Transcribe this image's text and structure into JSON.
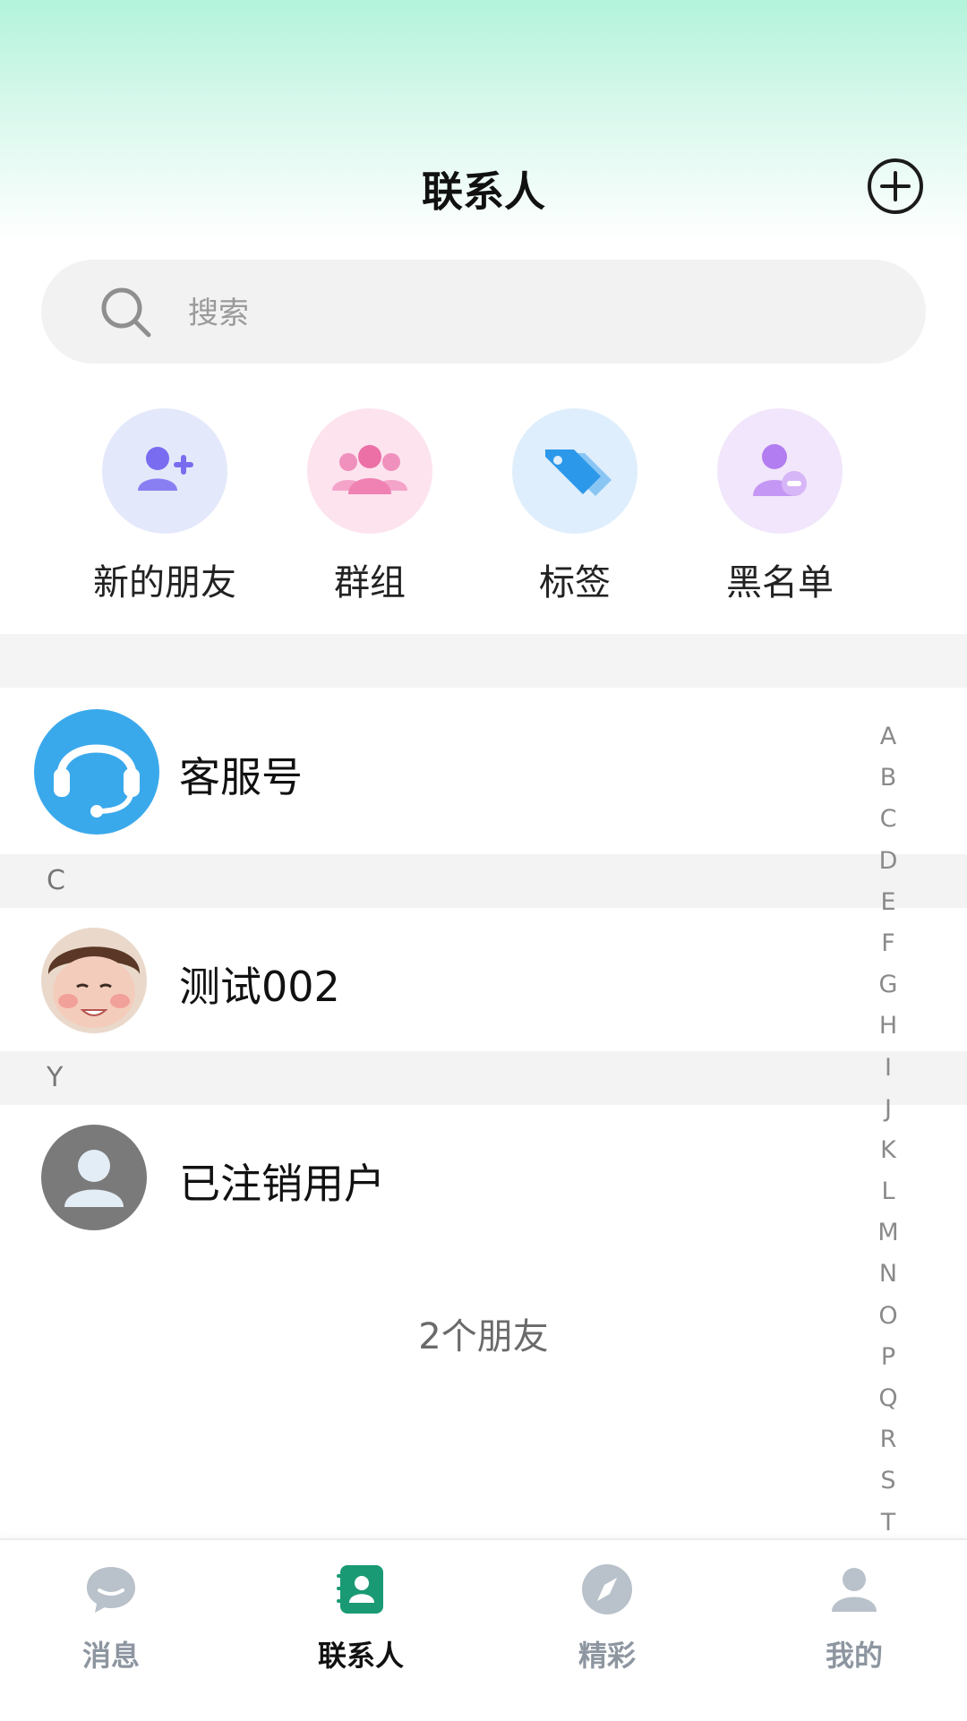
{
  "header": {
    "title": "联系人"
  },
  "search": {
    "placeholder": "搜索"
  },
  "quick_actions": [
    {
      "label": "新的朋友",
      "icon": "add-friend-icon"
    },
    {
      "label": "群组",
      "icon": "group-icon"
    },
    {
      "label": "标签",
      "icon": "tag-icon"
    },
    {
      "label": "黑名单",
      "icon": "blacklist-icon"
    }
  ],
  "contacts": {
    "service": {
      "name": "客服号"
    },
    "sections": [
      {
        "letter": "C",
        "items": [
          {
            "name": "测试002"
          }
        ]
      },
      {
        "letter": "Y",
        "items": [
          {
            "name": "已注销用户"
          }
        ]
      }
    ],
    "count_text": "2个朋友"
  },
  "index_letters": [
    "A",
    "B",
    "C",
    "D",
    "E",
    "F",
    "G",
    "H",
    "I",
    "J",
    "K",
    "L",
    "M",
    "N",
    "O",
    "P",
    "Q",
    "R",
    "S",
    "T"
  ],
  "tabbar": {
    "items": [
      {
        "label": "消息",
        "icon": "chat-bubble-icon",
        "active": false
      },
      {
        "label": "联系人",
        "icon": "contacts-icon",
        "active": true
      },
      {
        "label": "精彩",
        "icon": "compass-icon",
        "active": false
      },
      {
        "label": "我的",
        "icon": "person-icon",
        "active": false
      }
    ]
  },
  "colors": {
    "accent": "#1aa57a",
    "service_blue": "#3aa9ec",
    "header_gradient_top": "#b3f3dc"
  }
}
